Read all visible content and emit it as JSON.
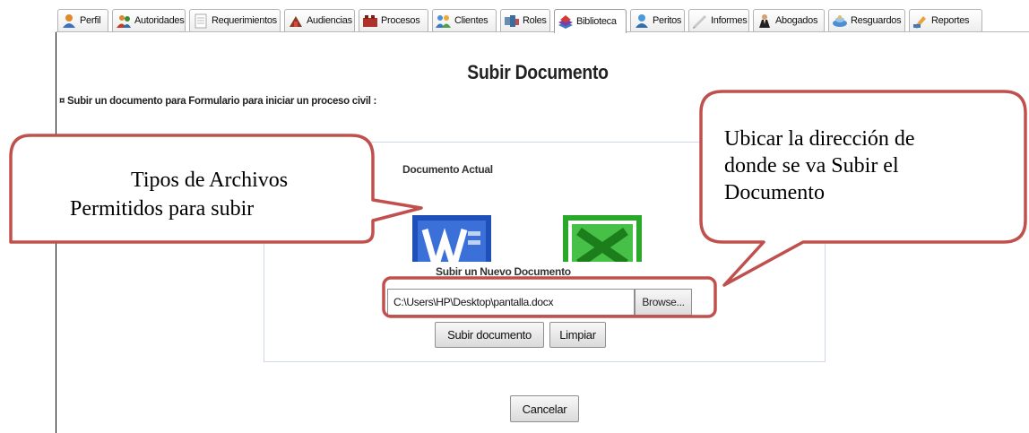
{
  "tabs": [
    {
      "label": "Perfil",
      "icon": "user-icon",
      "active": false
    },
    {
      "label": "Autoridades",
      "icon": "authorities-icon",
      "active": false
    },
    {
      "label": "Requerimientos",
      "icon": "document-icon",
      "active": false
    },
    {
      "label": "Audiencias",
      "icon": "gavel-icon",
      "active": false
    },
    {
      "label": "Procesos",
      "icon": "process-icon",
      "active": false
    },
    {
      "label": "Clientes",
      "icon": "clients-icon",
      "active": false
    },
    {
      "label": "Roles",
      "icon": "roles-icon",
      "active": false
    },
    {
      "label": "Biblioteca",
      "icon": "library-icon",
      "active": true
    },
    {
      "label": "Peritos",
      "icon": "expert-icon",
      "active": false
    },
    {
      "label": "Informes",
      "icon": "reports-icon",
      "active": false
    },
    {
      "label": "Abogados",
      "icon": "lawyer-icon",
      "active": false
    },
    {
      "label": "Resguardos",
      "icon": "safeguard-icon",
      "active": false
    },
    {
      "label": "Reportes",
      "icon": "pencil-icon",
      "active": false
    }
  ],
  "page": {
    "title": "Subir Documento",
    "subtitle": "¤ Subir un documento para Formulario para iniciar un proceso civil :"
  },
  "upload": {
    "current_doc_label": "Documento Actual",
    "new_doc_label": "Subir un Nuevo Documento",
    "file_path": "C:\\Users\\HP\\Desktop\\pantalla.docx",
    "browse_label": "Browse...",
    "upload_label": "Subir documento",
    "clear_label": "Limpiar",
    "allowed_icons": [
      "word-icon",
      "excel-icon"
    ]
  },
  "footer": {
    "cancel_label": "Cancelar"
  },
  "annotations": {
    "left_line1": "Tipos de Archivos",
    "left_line2": "Permitidos para subir",
    "right_line1": "Ubicar la dirección de",
    "right_line2": "donde se va Subir el",
    "right_line3": "Documento"
  },
  "colors": {
    "callout_border": "#c0504d",
    "word_blue": "#1f4fb8",
    "excel_green": "#2aa82a"
  }
}
